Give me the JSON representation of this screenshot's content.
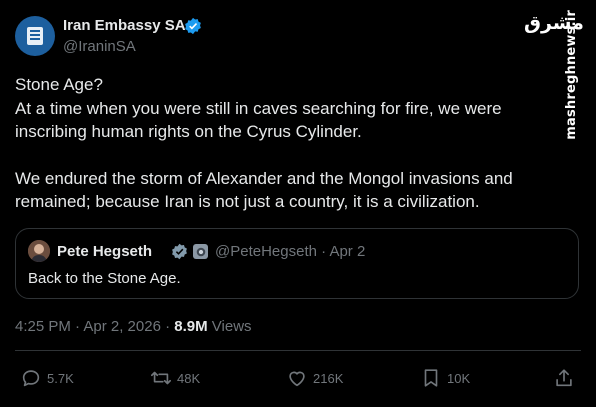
{
  "author": {
    "name": "Iran Embassy SA",
    "handle": "@IraninSA"
  },
  "tweet": {
    "line1": "Stone Age?",
    "line2": "At a time when you were still in caves searching for fire, we were inscribing human rights on the Cyrus Cylinder.",
    "para2": "We endured the storm of Alexander and the Mongol invasions and remained; because Iran is not just a country, it is a civilization."
  },
  "quote": {
    "name": "Pete Hegseth",
    "handle_date": "@PeteHegseth · Apr 2",
    "text": "Back to the Stone Age."
  },
  "meta": {
    "timestamp": "4:25 PM · Apr 2, 2026 · ",
    "views_count": "8.9M",
    "views_label": " Views"
  },
  "actions": {
    "replies": "5.7K",
    "reposts": "48K",
    "likes": "216K",
    "bookmarks": "10K"
  },
  "watermark": {
    "logo": "مشرق",
    "url": "mashreghnews.ir"
  },
  "colors": {
    "background": "#000000",
    "text": "#e7e9ea",
    "muted": "#71767b",
    "border": "#2f3336",
    "verified_blue": "#1d9bf0"
  },
  "icons": [
    "embassy-emblem-icon",
    "verified-badge-icon",
    "government-badge-icon",
    "reply-icon",
    "repost-icon",
    "like-icon",
    "bookmark-icon",
    "share-icon"
  ]
}
